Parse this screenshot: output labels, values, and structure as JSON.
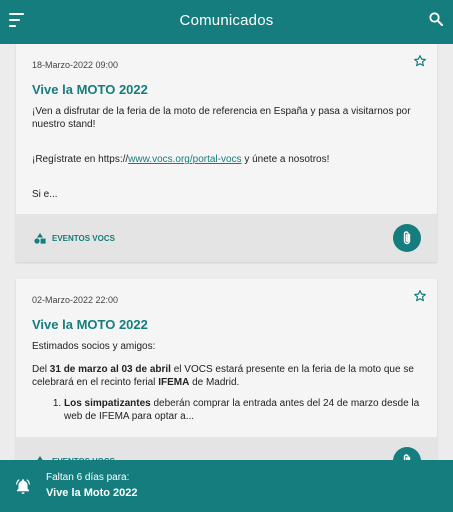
{
  "app_bar": {
    "title": "Comunicados"
  },
  "posts": [
    {
      "date": "18-Marzo-2022 09:00",
      "title": "Vive la MOTO 2022",
      "p1": "¡Ven a disfrutar de la feria de la moto de referencia en España y pasa a visitarnos por nuestro stand!",
      "p2_before": "¡Regístrate en https://",
      "p2_link": "www.vocs.org/portal-vocs",
      "p2_after": " y únete a nosotros!",
      "p3": "Si e...",
      "category": "EVENTOS VOCS"
    },
    {
      "date": "02-Marzo-2022 22:00",
      "title": "Vive la MOTO 2022",
      "p1": "Estimados socios y amigos:",
      "p2_a": "Del ",
      "p2_b": "31 de marzo al 03 de abril",
      "p2_c": " el VOCS estará presente en la feria de la moto que se celebrará en el recinto ferial ",
      "p2_d": "IFEMA",
      "p2_e": " de Madrid.",
      "li_bold": "Los simpatizantes",
      "li_rest": " deberán comprar la entrada antes del 24 de marzo desde la web de IFEMA para optar a...",
      "category": "EVENTOS VOCS"
    }
  ],
  "countdown": {
    "line1": "Faltan 6 días para:",
    "line2": "Vive la Moto 2022"
  },
  "colors": {
    "primary": "#157d7d",
    "card": "#f5f5f5",
    "background": "#ececec"
  },
  "icons": [
    "menu-icon",
    "search-icon",
    "star-icon",
    "category-shapes-icon",
    "paperclip-icon",
    "bell-icon"
  ]
}
